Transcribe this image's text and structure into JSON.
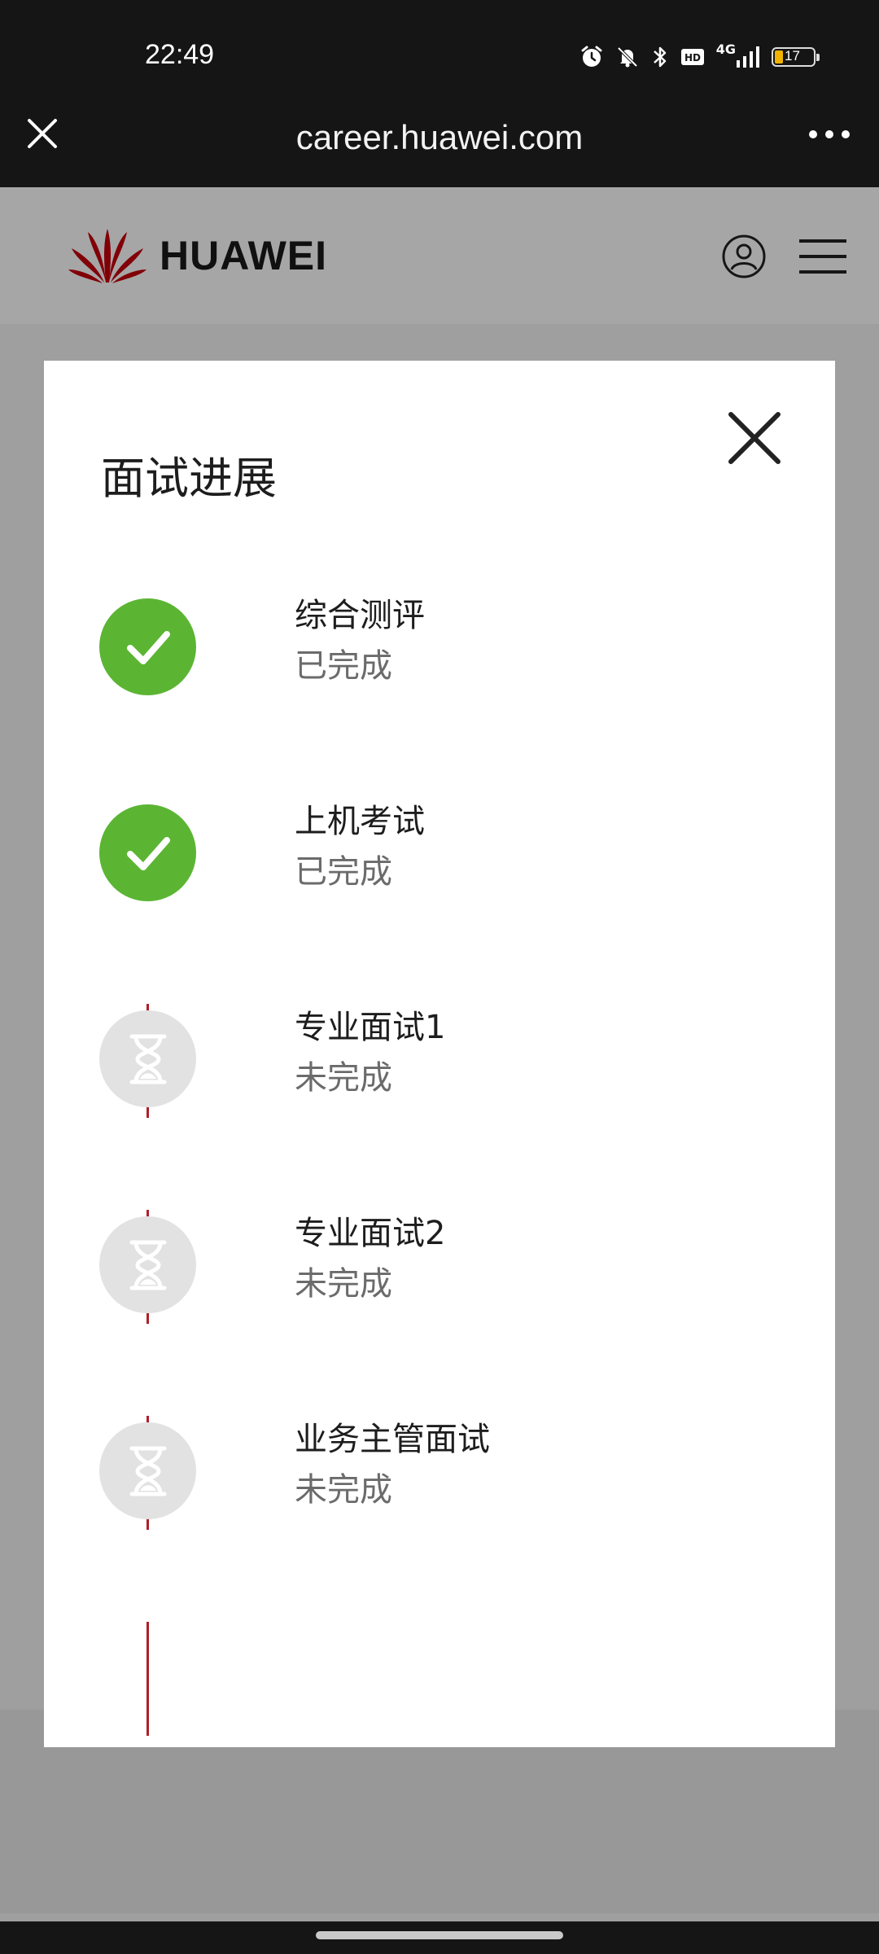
{
  "status_bar": {
    "time": "22:49",
    "network": "4G",
    "battery_level": "17",
    "icons": [
      "alarm-icon",
      "mute-icon",
      "bluetooth-icon",
      "hd-icon",
      "signal-icon",
      "battery-icon"
    ]
  },
  "browser": {
    "url": "career.huawei.com",
    "close_icon": "close-icon",
    "more_icon": "more-icon"
  },
  "site_header": {
    "brand": "HUAWEI",
    "brand_color": "#c7000b",
    "user_icon": "user-icon",
    "menu_icon": "menu-icon"
  },
  "modal": {
    "title": "面试进展",
    "close_icon": "close-icon",
    "steps": [
      {
        "title": "综合测评",
        "status": "已完成",
        "state": "done",
        "icon": "check-icon"
      },
      {
        "title": "上机考试",
        "status": "已完成",
        "state": "done",
        "icon": "check-icon"
      },
      {
        "title": "专业面试1",
        "status": "未完成",
        "state": "pending",
        "icon": "hourglass-icon"
      },
      {
        "title": "专业面试2",
        "status": "未完成",
        "state": "pending",
        "icon": "hourglass-icon"
      },
      {
        "title": "业务主管面试",
        "status": "未完成",
        "state": "pending",
        "icon": "hourglass-icon"
      }
    ]
  },
  "colors": {
    "done": "#5bb533",
    "pending": "#e2e2e2",
    "connector": "#b01e28"
  }
}
